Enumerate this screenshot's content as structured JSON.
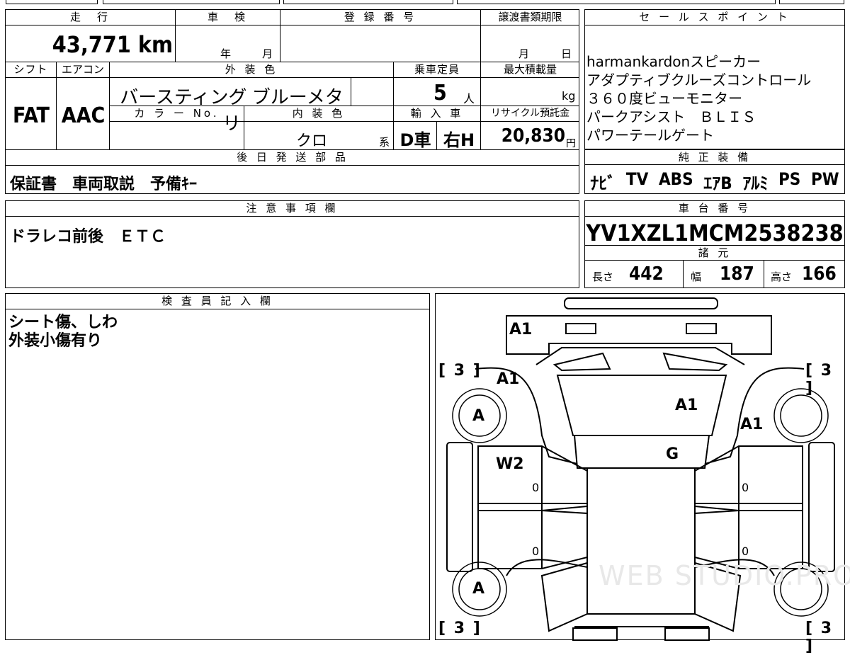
{
  "top": {
    "headers": {
      "mileage": "走　行",
      "inspection": "車　検",
      "registration": "登 録 番 号",
      "transfer_deadline": "譲渡書類期限",
      "sales_point": "セ ー ル ス ポ イ ン ト"
    },
    "mileage": "43,771 km",
    "inspection_year": "年",
    "inspection_month": "月",
    "transfer_month": "月",
    "transfer_day": "日"
  },
  "row2": {
    "headers": {
      "shift": "シフト",
      "aircon": "エアコン",
      "exterior_color": "外 装 色",
      "capacity": "乗車定員",
      "max_load": "最大積載量",
      "color_no": "カ ラ ー No.",
      "interior_color": "内 装 色",
      "import": "輸 入 車",
      "recycle": "リサイクル預託金"
    },
    "shift": "FAT",
    "aircon": "AAC",
    "exterior_color": "バースティング ブルーメタリ",
    "capacity": "5",
    "capacity_unit": "人",
    "max_load_unit": "kg",
    "interior_color": "クロ",
    "interior_suffix": "系",
    "import_d": "D車",
    "import_h": "右H",
    "recycle": "20,830",
    "recycle_unit": "円"
  },
  "later_parts": {
    "header": "後 日 発 送 部 品",
    "value": "保証書　車両取説　予備ｷｰ"
  },
  "sales_points": [
    "harmankardonスピーカー",
    "アダプティブクルーズコントロール",
    "３６０度ビューモニター",
    "パークアシスト　ＢＬＩＳ",
    "パワーテールゲート"
  ],
  "equipment": {
    "header": "純 正 装 備",
    "items": [
      "ﾅﾋﾞ",
      "TV",
      "ABS",
      "ｴｱB",
      "ｱﾙﾐ",
      "PS",
      "PW"
    ]
  },
  "notes": {
    "header": "注 意 事 項 欄",
    "value": "ドラレコ前後　ＥＴＣ"
  },
  "chassis": {
    "header": "車 台 番 号",
    "value": "YV1XZL1MCM2538238"
  },
  "specs": {
    "header": "諸 元",
    "length_label": "長さ",
    "length": "442",
    "width_label": "幅",
    "width": "187",
    "height_label": "高さ",
    "height": "166"
  },
  "inspector": {
    "header": "検 査 員 記 入 欄",
    "line1": "シート傷、しわ",
    "line2": "外装小傷有り"
  },
  "diagram": {
    "marks": {
      "front_bumper": "A1",
      "front_left": "A1",
      "hood": "A1",
      "front_right": "A1",
      "windshield": "G",
      "door": "W2",
      "tire_front": "A",
      "tire_rear": "A"
    },
    "tread": "3",
    "zero": "0",
    "watermark": "WEB STUDIO.PRO"
  }
}
